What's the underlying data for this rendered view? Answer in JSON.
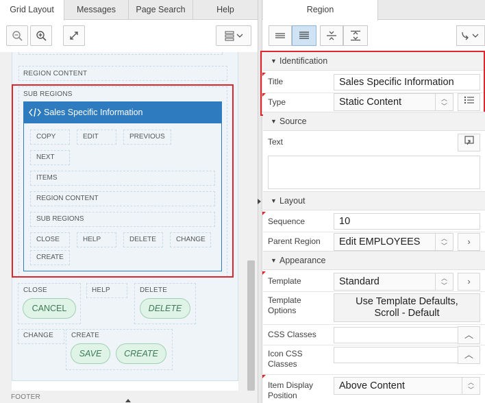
{
  "left_tabs": [
    "Grid Layout",
    "Messages",
    "Page Search",
    "Help"
  ],
  "region_content_top": "REGION CONTENT",
  "sub_regions": {
    "label": "SUB REGIONS",
    "card_title": "Sales Specific Information",
    "buttons_row1": [
      "COPY",
      "EDIT",
      "PREVIOUS"
    ],
    "next": "NEXT",
    "items": "ITEMS",
    "region_content": "REGION CONTENT",
    "sub_regions": "SUB REGIONS",
    "buttons_row2": [
      "CLOSE",
      "HELP",
      "DELETE",
      "CHANGE"
    ],
    "create": "CREATE"
  },
  "lower": {
    "close": "CLOSE",
    "cancel": "CANCEL",
    "help": "HELP",
    "delete": "DELETE",
    "delete_btn": "DELETE",
    "change": "CHANGE",
    "create": "CREATE",
    "save_btn": "SAVE",
    "create_btn": "CREATE",
    "footer": "FOOTER"
  },
  "right": {
    "tab": "Region",
    "sections": {
      "identification": "Identification",
      "source": "Source",
      "layout": "Layout",
      "appearance": "Appearance"
    },
    "props": {
      "title_label": "Title",
      "title_value": "Sales Specific Information",
      "type_label": "Type",
      "type_value": "Static Content",
      "text_label": "Text",
      "text_value": "",
      "sequence_label": "Sequence",
      "sequence_value": "10",
      "parent_label": "Parent Region",
      "parent_value": "Edit EMPLOYEES",
      "template_label": "Template",
      "template_value": "Standard",
      "template_options_label": "Template Options",
      "template_options_value": "Use Template Defaults, Scroll - Default",
      "css_label": "CSS Classes",
      "css_value": "",
      "icon_css_label": "Icon CSS Classes",
      "icon_css_value": "",
      "item_display_label": "Item Display Position",
      "item_display_value": "Above Content"
    }
  },
  "colors": {
    "highlight": "#e0262b",
    "card_header": "#2f7bbf",
    "button_green": "#dff3e7"
  }
}
